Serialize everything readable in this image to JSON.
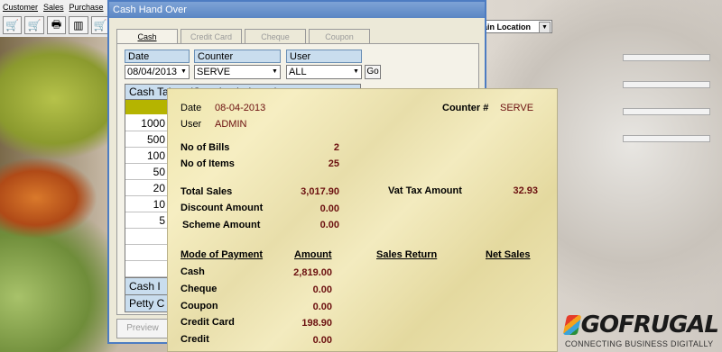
{
  "menu": [
    "Customer",
    "Sales",
    "Purchase"
  ],
  "toolbar_icons": [
    "cart-icon",
    "cart-icon",
    "printer-icon",
    "barcode-icon",
    "cart-icon"
  ],
  "location": {
    "label": "ain Location"
  },
  "window": {
    "title": "Cash Hand Over",
    "tabs": [
      "Cash",
      "Credit Card",
      "Cheque",
      "Coupon"
    ],
    "filters": {
      "date_label": "Date",
      "date_value": "08/04/2013",
      "counter_label": "Counter",
      "counter_value": "SERVE",
      "user_label": "User",
      "user_value": "ALL",
      "go_label": "Go"
    },
    "grid": {
      "header": "Cash Taken (Opening balance)",
      "rows": [
        "1000",
        "500",
        "100",
        "50",
        "20",
        "10",
        "5",
        "",
        "",
        "",
        ""
      ],
      "footers": [
        "Cash I",
        "Petty C"
      ]
    },
    "preview_label": "Preview"
  },
  "report": {
    "date_label": "Date",
    "date_value": "08-04-2013",
    "counter_label": "Counter #",
    "counter_value": "SERVE",
    "user_label": "User",
    "user_value": "ADMIN",
    "bills_label": "No of Bills",
    "bills_value": "2",
    "items_label": "No of Items",
    "items_value": "25",
    "total_sales_label": "Total Sales",
    "total_sales_value": "3,017.90",
    "vat_label": "Vat Tax Amount",
    "vat_value": "32.93",
    "discount_label": "Discount Amount",
    "discount_value": "0.00",
    "scheme_label": "Scheme Amount",
    "scheme_value": "0.00",
    "headers": {
      "mode": "Mode of Payment",
      "amount": "Amount",
      "sales_return": "Sales Return",
      "net_sales": "Net Sales"
    },
    "payments": [
      {
        "mode": "Cash",
        "amount": "2,819.00"
      },
      {
        "mode": "Cheque",
        "amount": "0.00"
      },
      {
        "mode": "Coupon",
        "amount": "0.00"
      },
      {
        "mode": "Credit Card",
        "amount": "198.90"
      },
      {
        "mode": "Credit",
        "amount": "0.00"
      }
    ]
  },
  "logo": {
    "name": "GOFRUGAL",
    "tagline": "CONNECTING BUSINESS DIGITALLY"
  }
}
